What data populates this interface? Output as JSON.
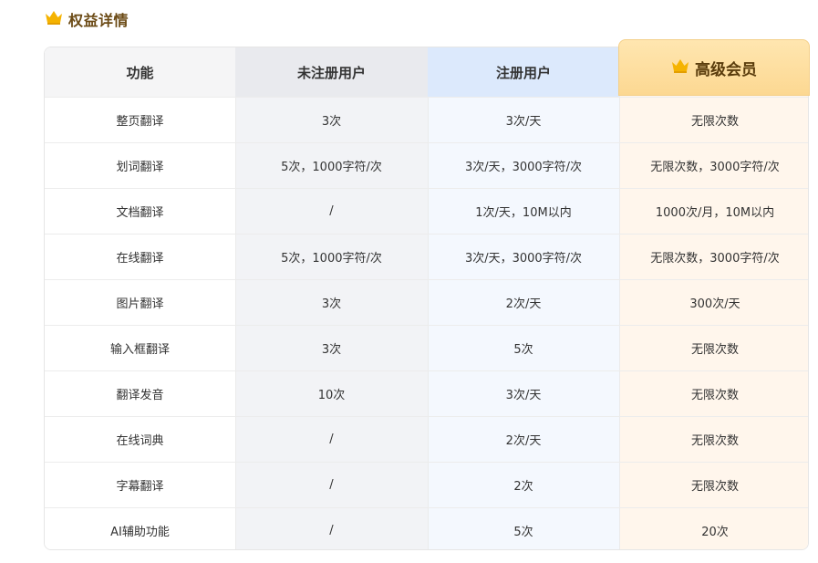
{
  "section": {
    "title": "权益详情",
    "icon": "crown-icon"
  },
  "colors": {
    "crown": "#f5b301",
    "premium_header": "#fcd892",
    "premium_column": "#fff6ec",
    "registered_header": "#dce9fc",
    "registered_column": "#f4f8fe",
    "unregistered_header": "#e9eaee",
    "unregistered_column": "#f2f3f6"
  },
  "table": {
    "headers": [
      "功能",
      "未注册用户",
      "注册用户",
      "高级会员"
    ],
    "rows": [
      [
        "整页翻译",
        "3次",
        "3次/天",
        "无限次数"
      ],
      [
        "划词翻译",
        "5次，1000字符/次",
        "3次/天，3000字符/次",
        "无限次数，3000字符/次"
      ],
      [
        "文档翻译",
        "/",
        "1次/天，10M以内",
        "1000次/月，10M以内"
      ],
      [
        "在线翻译",
        "5次，1000字符/次",
        "3次/天，3000字符/次",
        "无限次数，3000字符/次"
      ],
      [
        "图片翻译",
        "3次",
        "2次/天",
        "300次/天"
      ],
      [
        "输入框翻译",
        "3次",
        "5次",
        "无限次数"
      ],
      [
        "翻译发音",
        "10次",
        "3次/天",
        "无限次数"
      ],
      [
        "在线词典",
        "/",
        "2次/天",
        "无限次数"
      ],
      [
        "字幕翻译",
        "/",
        "2次",
        "无限次数"
      ],
      [
        "AI辅助功能",
        "/",
        "5次",
        "20次"
      ]
    ]
  }
}
